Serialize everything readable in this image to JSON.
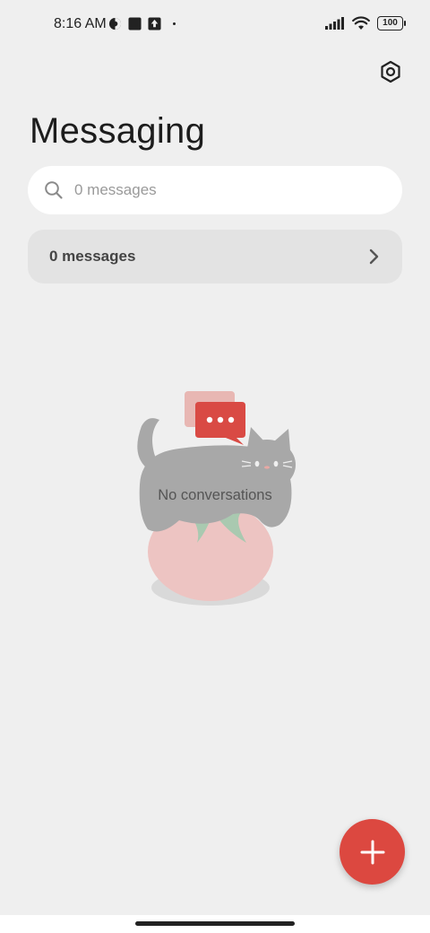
{
  "status_bar": {
    "time": "8:16 AM",
    "battery": "100",
    "icons": [
      "vpn-icon",
      "square-icon",
      "upload-icon",
      "dot-icon",
      "signal-icon",
      "wifi-icon",
      "battery-icon"
    ]
  },
  "header": {
    "title": "Messaging",
    "settings_icon": "settings-icon"
  },
  "search": {
    "placeholder": "0 messages",
    "value": ""
  },
  "summary_row": {
    "label": "0 messages"
  },
  "empty_state": {
    "text": "No conversations"
  },
  "fab": {
    "icon": "plus-icon"
  },
  "colors": {
    "background": "#efefef",
    "accent": "#dc4840",
    "search_bg": "#ffffff",
    "row_bg": "#e3e3e3"
  }
}
